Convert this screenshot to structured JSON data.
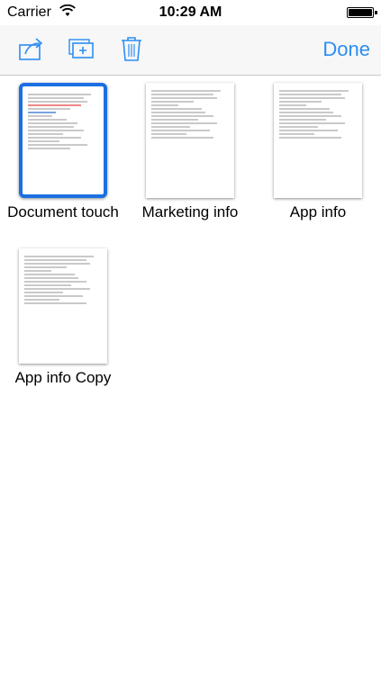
{
  "status_bar": {
    "carrier": "Carrier",
    "time": "10:29 AM"
  },
  "toolbar": {
    "share_icon": "share-icon",
    "new_icon": "add-document-icon",
    "trash_icon": "trash-icon",
    "done_label": "Done",
    "accent_color": "#2b8ef0"
  },
  "documents": [
    {
      "name": "Document touch",
      "selected": true
    },
    {
      "name": "Marketing info",
      "selected": false
    },
    {
      "name": "App info",
      "selected": false
    },
    {
      "name": "App info Copy",
      "selected": false
    }
  ]
}
